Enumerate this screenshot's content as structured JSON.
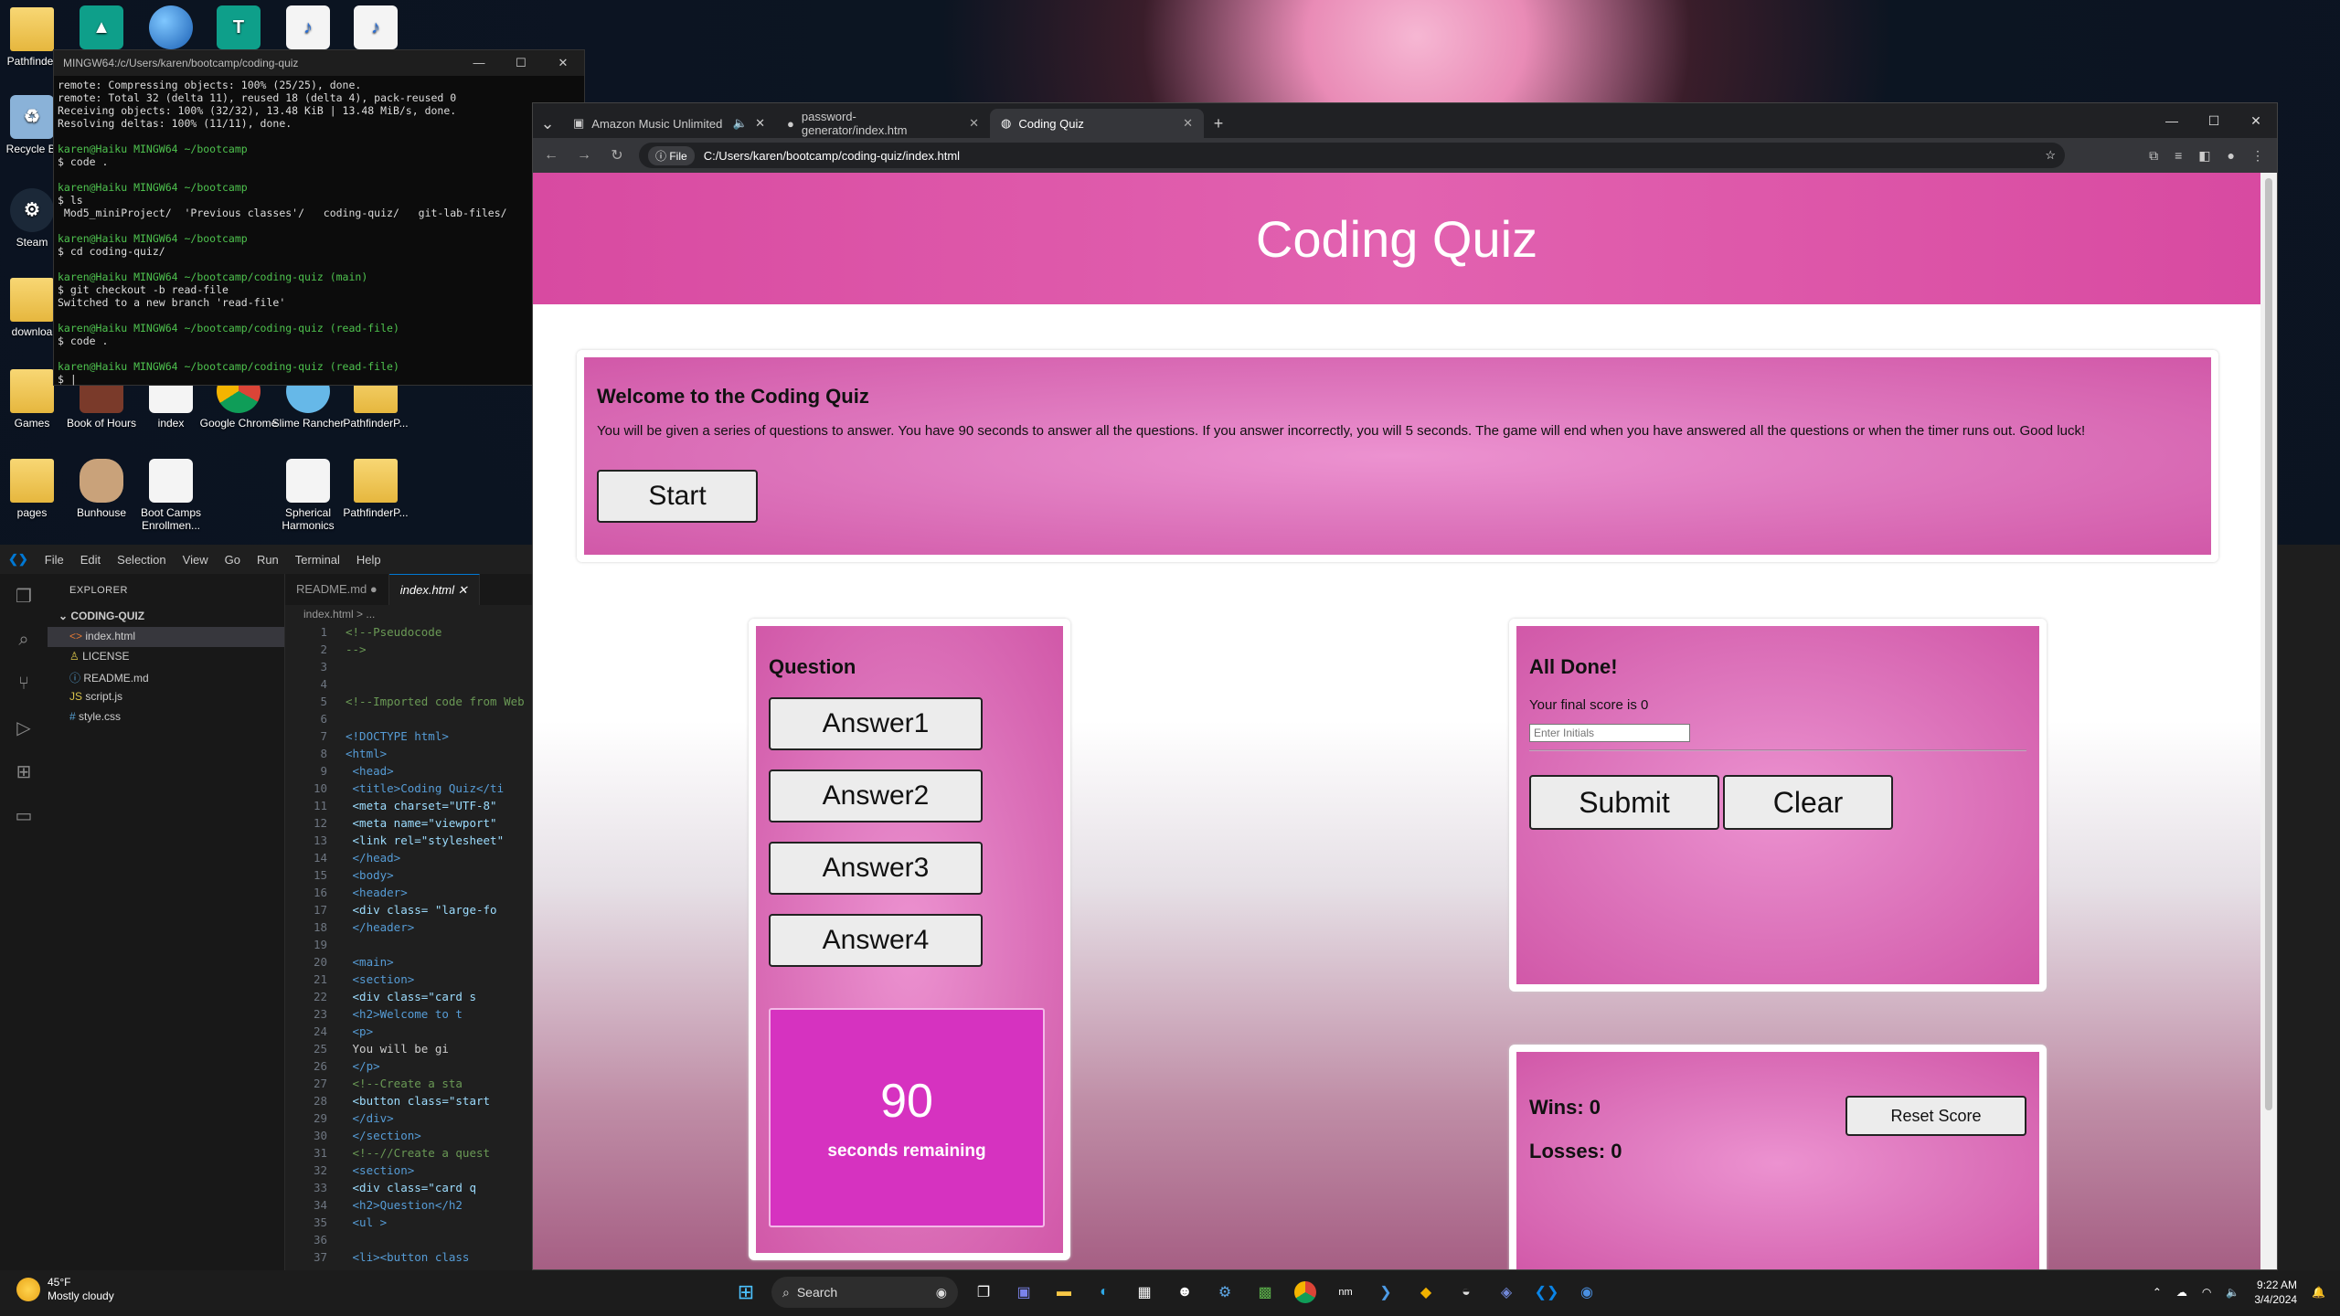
{
  "desktop": {
    "icons": [
      {
        "label": "Pathfinder"
      },
      {
        "label": "Recycle Bi"
      },
      {
        "label": "Steam"
      },
      {
        "label": "downloa"
      },
      {
        "label": "Games"
      },
      {
        "label": "Book of Hours"
      },
      {
        "label": "index"
      },
      {
        "label": "Google Chrome"
      },
      {
        "label": "Slime Rancher"
      },
      {
        "label": "PathfinderP..."
      },
      {
        "label": "pages"
      },
      {
        "label": "Bunhouse"
      },
      {
        "label": "Boot Camps Enrollmen..."
      },
      {
        "label": "Spherical Harmonics"
      },
      {
        "label": "PathfinderP..."
      }
    ]
  },
  "terminal": {
    "title": "MINGW64:/c/Users/karen/bootcamp/coding-quiz",
    "lines": [
      "remote: Compressing objects: 100% (25/25), done.",
      "remote: Total 32 (delta 11), reused 18 (delta 4), pack-reused 0",
      "Receiving objects: 100% (32/32), 13.48 KiB | 13.48 MiB/s, done.",
      "Resolving deltas: 100% (11/11), done.",
      "",
      "karen@Haiku MINGW64 ~/bootcamp",
      "$ code .",
      "",
      "karen@Haiku MINGW64 ~/bootcamp",
      "$ ls",
      " Mod5_miniProject/  'Previous classes'/   coding-quiz/   git-lab-files/",
      "",
      "karen@Haiku MINGW64 ~/bootcamp",
      "$ cd coding-quiz/",
      "",
      "karen@Haiku MINGW64 ~/bootcamp/coding-quiz (main)",
      "$ git checkout -b read-file",
      "Switched to a new branch 'read-file'",
      "",
      "karen@Haiku MINGW64 ~/bootcamp/coding-quiz (read-file)",
      "$ code .",
      "",
      "karen@Haiku MINGW64 ~/bootcamp/coding-quiz (read-file)",
      "$ |"
    ]
  },
  "vscode": {
    "menu": [
      "File",
      "Edit",
      "Selection",
      "View",
      "Go",
      "Run",
      "Terminal",
      "Help"
    ],
    "explorer_title": "EXPLORER",
    "folder": "CODING-QUIZ",
    "files": [
      "index.html",
      "LICENSE",
      "README.md",
      "script.js",
      "style.css"
    ],
    "tabs": [
      "README.md",
      "index.html"
    ],
    "breadcrumb": "index.html > ...",
    "code": [
      {
        "n": "1",
        "t": "<!--Pseudocode",
        "c": "c-cmt"
      },
      {
        "n": "2",
        "t": "-->",
        "c": "c-cmt"
      },
      {
        "n": "3",
        "t": "",
        "c": "c-txt"
      },
      {
        "n": "4",
        "t": "",
        "c": "c-txt"
      },
      {
        "n": "5",
        "t": "<!--Imported code from Web",
        "c": "c-cmt"
      },
      {
        "n": "6",
        "t": "",
        "c": "c-txt"
      },
      {
        "n": "7",
        "t": "<!DOCTYPE html>",
        "c": "c-tag"
      },
      {
        "n": "8",
        "t": "<html>",
        "c": "c-tag"
      },
      {
        "n": "9",
        "t": "  <head>",
        "c": "c-tag"
      },
      {
        "n": "10",
        "t": "    <title>Coding Quiz</ti",
        "c": "c-tag"
      },
      {
        "n": "11",
        "t": "    <meta charset=\"UTF-8\"",
        "c": "c-attr"
      },
      {
        "n": "12",
        "t": "    <meta name=\"viewport\"",
        "c": "c-attr"
      },
      {
        "n": "13",
        "t": "    <link rel=\"stylesheet\"",
        "c": "c-attr"
      },
      {
        "n": "14",
        "t": "  </head>",
        "c": "c-tag"
      },
      {
        "n": "15",
        "t": "  <body>",
        "c": "c-tag"
      },
      {
        "n": "16",
        "t": "    <header>",
        "c": "c-tag"
      },
      {
        "n": "17",
        "t": "      <div class= \"large-fo",
        "c": "c-attr"
      },
      {
        "n": "18",
        "t": "          </header>",
        "c": "c-tag"
      },
      {
        "n": "19",
        "t": "",
        "c": "c-txt"
      },
      {
        "n": "20",
        "t": "    <main>",
        "c": "c-tag"
      },
      {
        "n": "21",
        "t": "      <section>",
        "c": "c-tag"
      },
      {
        "n": "22",
        "t": "        <div class=\"card s",
        "c": "c-attr"
      },
      {
        "n": "23",
        "t": "          <h2>Welcome to t",
        "c": "c-tag"
      },
      {
        "n": "24",
        "t": "          <p>",
        "c": "c-tag"
      },
      {
        "n": "25",
        "t": "            You will be gi",
        "c": "c-txt"
      },
      {
        "n": "26",
        "t": "          </p>",
        "c": "c-tag"
      },
      {
        "n": "27",
        "t": "          <!--Create a sta",
        "c": "c-cmt"
      },
      {
        "n": "28",
        "t": "      <button class=\"start",
        "c": "c-attr"
      },
      {
        "n": "29",
        "t": "        </div>",
        "c": "c-tag"
      },
      {
        "n": "30",
        "t": "      </section>",
        "c": "c-tag"
      },
      {
        "n": "31",
        "t": "      <!--//Create a quest",
        "c": "c-cmt"
      },
      {
        "n": "32",
        "t": "      <section>",
        "c": "c-tag"
      },
      {
        "n": "33",
        "t": "        <div class=\"card q",
        "c": "c-attr"
      },
      {
        "n": "34",
        "t": "          <h2>Question</h2",
        "c": "c-tag"
      },
      {
        "n": "35",
        "t": "          <ul >",
        "c": "c-tag"
      },
      {
        "n": "36",
        "t": "",
        "c": "c-txt"
      },
      {
        "n": "37",
        "t": "            <li><button class",
        "c": "c-tag"
      }
    ]
  },
  "browser": {
    "tabs": [
      {
        "label": "Amazon Music Unlimited"
      },
      {
        "label": "password-generator/index.htm"
      },
      {
        "label": "Coding Quiz"
      }
    ],
    "address_chip": "File",
    "address": "C:/Users/karen/bootcamp/coding-quiz/index.html"
  },
  "quiz": {
    "title": "Coding Quiz",
    "welcome_heading": "Welcome to the Coding Quiz",
    "welcome_text": "You will be given a series of questions to answer. You have 90 seconds to answer all the questions. If you answer incorrectly, you will 5 seconds. The game will end when you have answered all the questions or when the timer runs out. Good luck!",
    "start_label": "Start",
    "question_heading": "Question",
    "answers": [
      "Answer1",
      "Answer2",
      "Answer3",
      "Answer4"
    ],
    "timer_value": "90",
    "timer_label": "seconds remaining",
    "done_heading": "All Done!",
    "final_score_text": "Your final score is 0",
    "initials_placeholder": "Enter Initials",
    "submit_label": "Submit",
    "clear_label": "Clear",
    "wins_text": "Wins: 0",
    "losses_text": "Losses: 0",
    "reset_label": "Reset Score"
  },
  "taskbar": {
    "weather_temp": "45°F",
    "weather_desc": "Mostly cloudy",
    "search_label": "Search",
    "time": "9:22 AM",
    "date": "3/4/2024"
  }
}
